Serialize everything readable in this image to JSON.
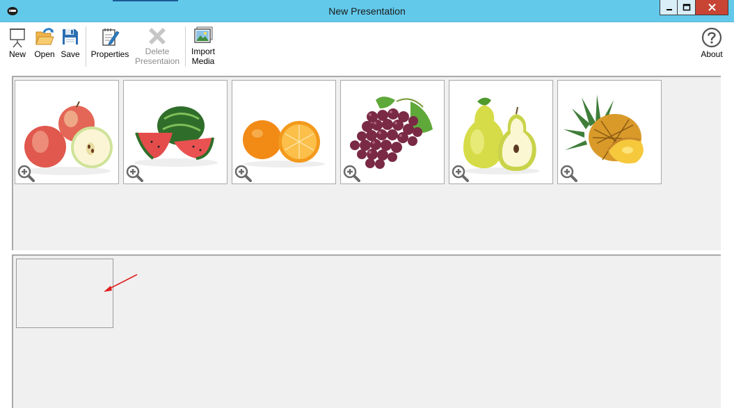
{
  "window": {
    "title": "New Presentation",
    "colors": {
      "titlebar": "#62c9ea",
      "close": "#c84434"
    }
  },
  "toolbar": {
    "new": {
      "label": "New",
      "icon": "presentation-board-icon"
    },
    "open": {
      "label": "Open",
      "icon": "folder-open-icon"
    },
    "save": {
      "label": "Save",
      "icon": "floppy-disk-icon"
    },
    "properties": {
      "label": "Properties",
      "icon": "notepad-pen-icon"
    },
    "delete": {
      "label_line1": "Delete",
      "label_line2": "Presentaion",
      "icon": "delete-x-icon",
      "enabled": false
    },
    "import": {
      "label_line1": "Import",
      "label_line2": "Media",
      "icon": "picture-icon"
    },
    "about": {
      "label": "About",
      "icon": "help-circle-icon"
    }
  },
  "media": {
    "items": [
      {
        "name": "apples",
        "icon": "apple-image"
      },
      {
        "name": "watermelon",
        "icon": "watermelon-image"
      },
      {
        "name": "oranges",
        "icon": "orange-image"
      },
      {
        "name": "grapes",
        "icon": "grapes-image"
      },
      {
        "name": "pears",
        "icon": "pear-image"
      },
      {
        "name": "pineapples",
        "icon": "pineapple-image"
      }
    ],
    "zoom_icon": "zoom-in-icon"
  },
  "slides": {
    "count": 1,
    "annotation_color": "#e02020"
  }
}
